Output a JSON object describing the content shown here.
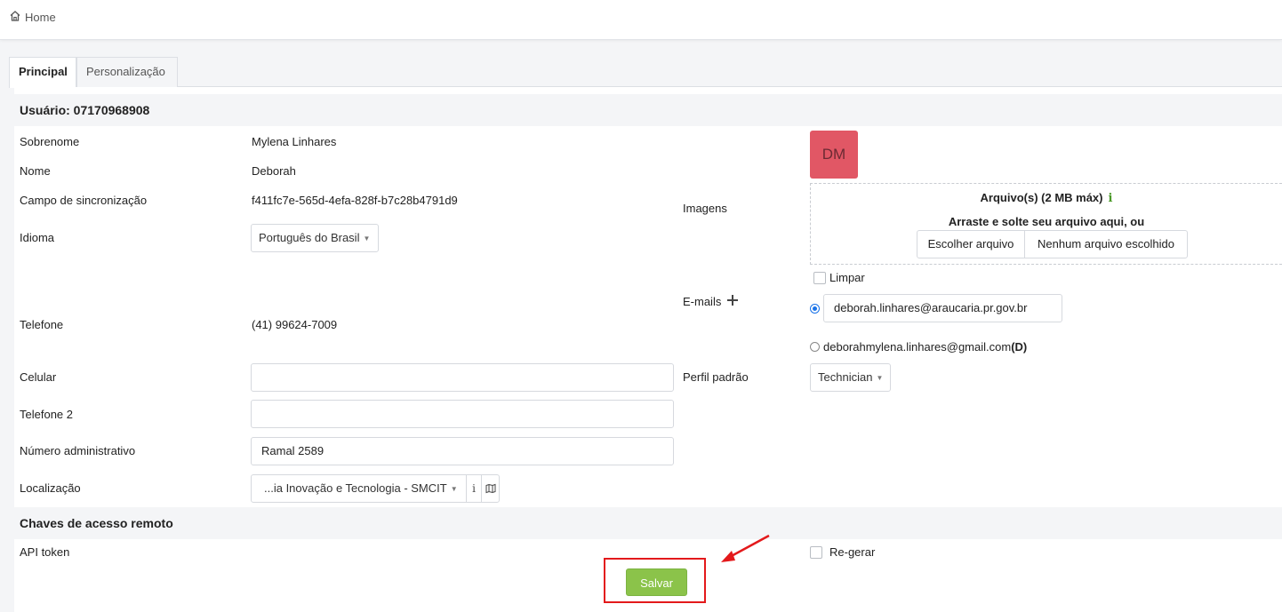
{
  "breadcrumb": {
    "home_label": "Home"
  },
  "tabs": [
    {
      "label": "Principal",
      "active": true
    },
    {
      "label": "Personalização",
      "active": false
    }
  ],
  "user_header": "Usuário: 07170968908",
  "fields": {
    "sobrenome": {
      "label": "Sobrenome",
      "value": "Mylena Linhares"
    },
    "nome": {
      "label": "Nome",
      "value": "Deborah"
    },
    "sync": {
      "label": "Campo de sincronização",
      "value": "f411fc7e-565d-4efa-828f-b7c28b4791d9"
    },
    "idioma": {
      "label": "Idioma",
      "value": "Português do Brasil"
    },
    "telefone": {
      "label": "Telefone",
      "value": "(41) 99624-7009"
    },
    "celular": {
      "label": "Celular",
      "value": ""
    },
    "telefone2": {
      "label": "Telefone 2",
      "value": ""
    },
    "numero_admin": {
      "label": "Número administrativo",
      "value": "Ramal 2589"
    },
    "localizacao": {
      "label": "Localização",
      "value": "...ia Inovação e Tecnologia - SMCIT"
    }
  },
  "images": {
    "label": "Imagens",
    "avatar_initials": "DM",
    "avatar_color": "#e15765",
    "upload_title": "Arquivo(s) (2 MB máx)",
    "info_icon": "i",
    "drop_text": "Arraste e solte seu arquivo aqui, ou",
    "choose_button": "Escolher arquivo",
    "no_file_text": "Nenhum arquivo escolhido",
    "clear_label": "Limpar"
  },
  "emails": {
    "label": "E-mails",
    "primary": "deborah.linhares@araucaria.pr.gov.br",
    "secondary": "deborahmylena.linhares@gmail.com",
    "secondary_flag": "(D)"
  },
  "perfil": {
    "label": "Perfil padrão",
    "value": "Technician"
  },
  "remote_keys": {
    "header": "Chaves de acesso remoto",
    "api_token_label": "API token",
    "regen_label": "Re-gerar"
  },
  "save_label": "Salvar",
  "colors": {
    "save": "#8bc34a",
    "annotation": "#e3191b",
    "radio": "#1a73e8",
    "info": "#4c9a2a"
  }
}
